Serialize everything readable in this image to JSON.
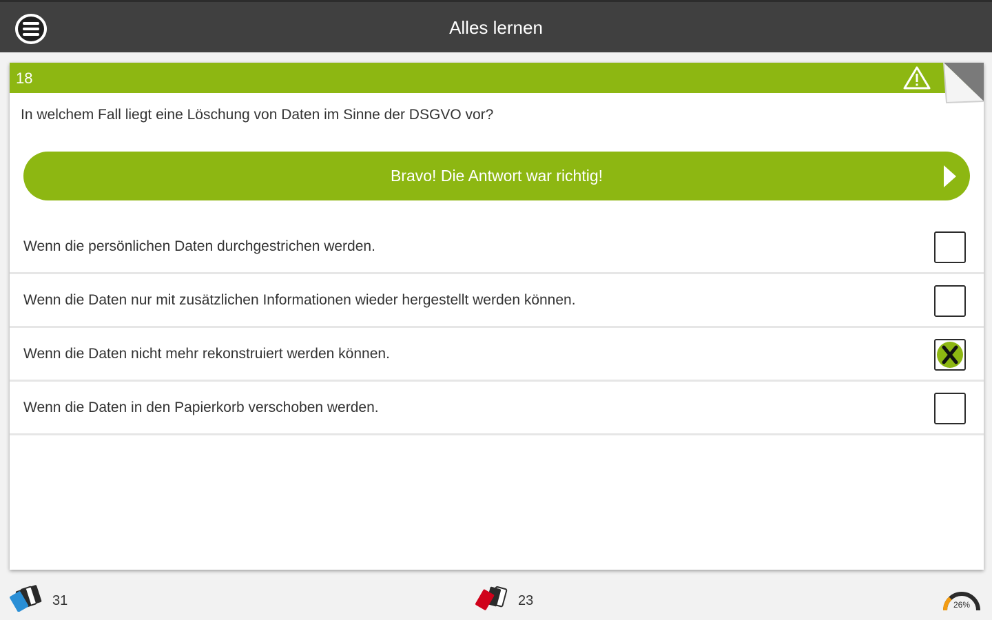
{
  "topbar": {
    "title": "Alles lernen"
  },
  "card": {
    "question_number": "18",
    "question": "In welchem Fall liegt eine Löschung von Daten im Sinne der DSGVO vor?",
    "feedback": "Bravo! Die Antwort war richtig!",
    "answers": [
      {
        "text": "Wenn die persönlichen Daten durchgestrichen werden.",
        "checked": false
      },
      {
        "text": "Wenn die Daten nur mit zusätzlichen Informationen wieder hergestellt werden können.",
        "checked": false
      },
      {
        "text": "Wenn die Daten nicht mehr rekonstruiert werden können.",
        "checked": true
      },
      {
        "text": "Wenn die Daten in den Papierkorb verschoben werden.",
        "checked": false
      }
    ]
  },
  "bottombar": {
    "learned_cards_count": "31",
    "wrong_cards_count": "23",
    "progress_label": "26%",
    "progress": 0.26
  },
  "colors": {
    "accent_green": "#8db712",
    "topbar": "#404040",
    "gauge_orange": "#f39c12",
    "wrong_red": "#d0021b",
    "learned_blue": "#2a8fd6"
  }
}
